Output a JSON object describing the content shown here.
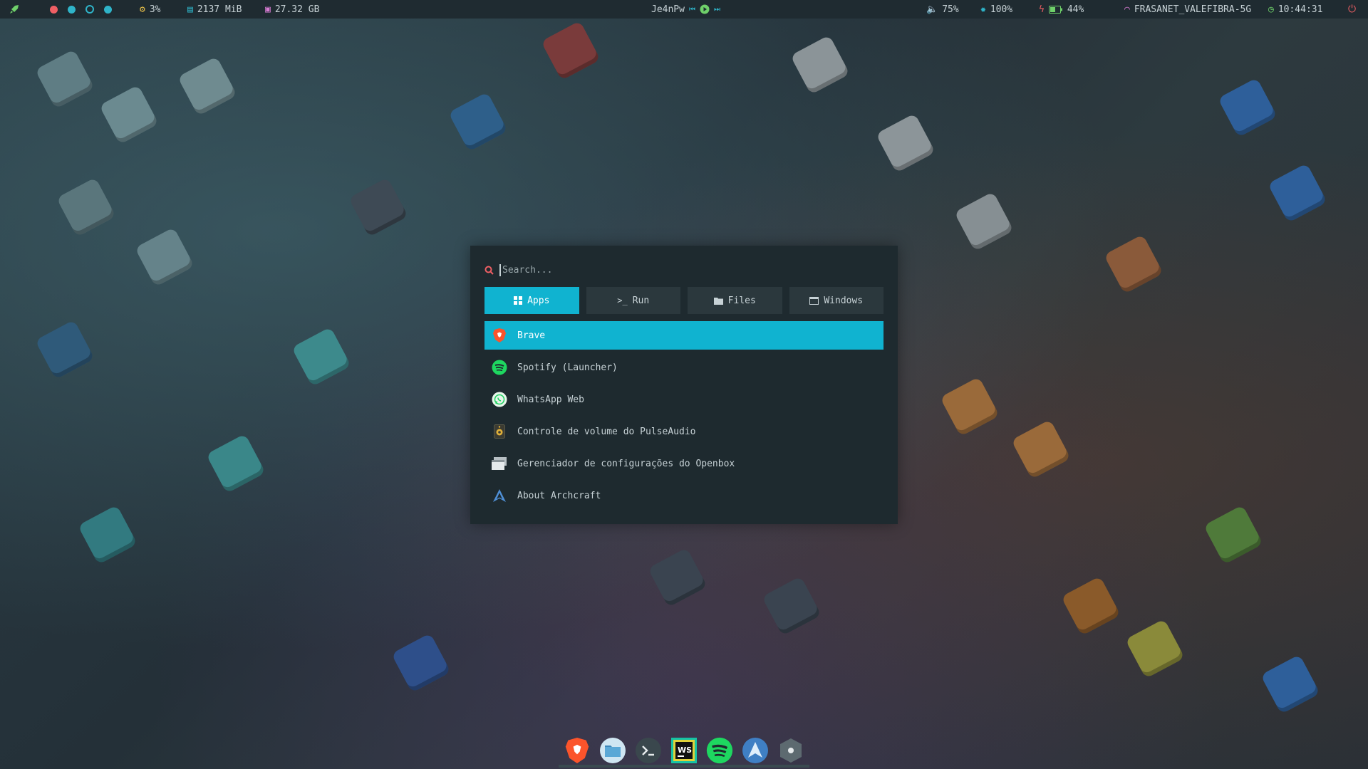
{
  "topbar": {
    "cpu": "3%",
    "memory": "2137 MiB",
    "disk": "27.32 GB",
    "media_title": "Je4nPw",
    "volume": "75%",
    "brightness": "100%",
    "battery": "44%",
    "wifi": "FRASANET_VALEFIBRA-5G",
    "clock": "10:44:31",
    "icons": [
      "rocket-icon",
      "red-dot",
      "cyan-dot",
      "ring-dot",
      "cyan-dot",
      "cpu-icon",
      "memory-icon",
      "disk-icon",
      "prev-icon",
      "play-icon",
      "next-icon",
      "volume-icon",
      "brightness-icon",
      "bolt-icon",
      "battery-icon",
      "wifi-icon",
      "clock-icon",
      "power-icon"
    ]
  },
  "launcher": {
    "search_placeholder": "Search...",
    "tabs": [
      {
        "label": "Apps",
        "icon": "grid-icon",
        "active": true
      },
      {
        "label": "Run",
        "icon": "terminal-prompt-icon",
        "active": false
      },
      {
        "label": "Files",
        "icon": "folder-icon",
        "active": false
      },
      {
        "label": "Windows",
        "icon": "window-icon",
        "active": false
      }
    ],
    "items": [
      {
        "label": "Brave",
        "icon": "brave-icon",
        "selected": true
      },
      {
        "label": "Spotify (Launcher)",
        "icon": "spotify-icon",
        "selected": false
      },
      {
        "label": "WhatsApp Web",
        "icon": "whatsapp-icon",
        "selected": false
      },
      {
        "label": "Controle de volume do PulseAudio",
        "icon": "speaker-icon",
        "selected": false
      },
      {
        "label": "Gerenciador de configurações do Openbox",
        "icon": "openbox-icon",
        "selected": false
      },
      {
        "label": "About Archcraft",
        "icon": "archcraft-icon",
        "selected": false
      }
    ]
  },
  "dock": {
    "items": [
      "brave-icon",
      "file-manager-icon",
      "terminal-icon",
      "webstorm-icon",
      "spotify-icon",
      "archcraft-icon",
      "settings-icon"
    ],
    "webstorm_text": "WS"
  },
  "colors": {
    "accent": "#10b3d0",
    "panel": "#1e2a2f",
    "bar": "#1f2b31"
  }
}
